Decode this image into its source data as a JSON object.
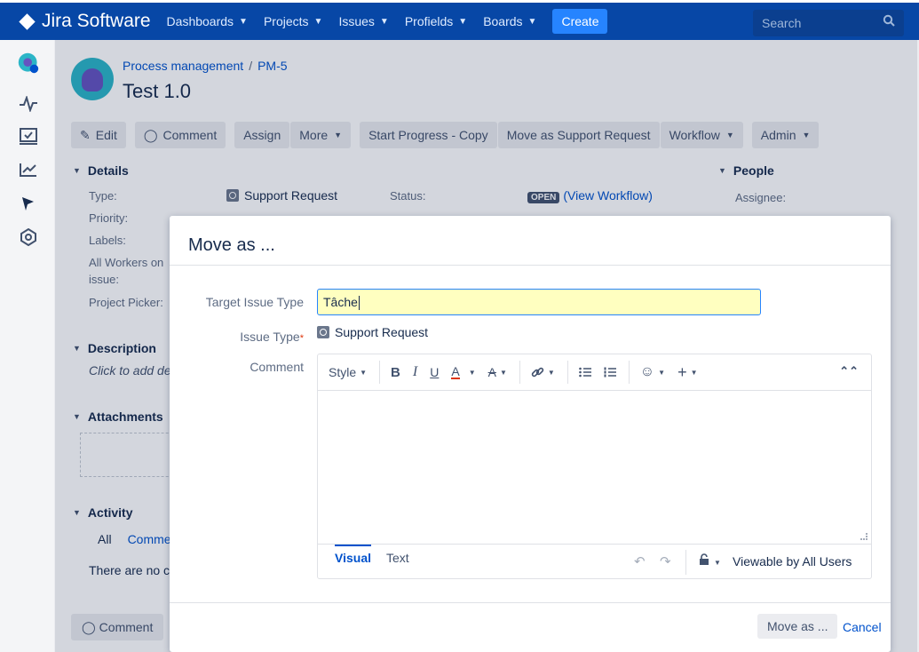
{
  "nav": {
    "brand": "Jira Software",
    "items": [
      "Dashboards",
      "Projects",
      "Issues",
      "Profields",
      "Boards"
    ],
    "create": "Create",
    "search_placeholder": "Search"
  },
  "issue": {
    "breadcrumb_project": "Process management",
    "breadcrumb_key": "PM-5",
    "title": "Test 1.0",
    "toolbar": {
      "edit": "Edit",
      "comment": "Comment",
      "assign": "Assign",
      "more": "More",
      "start_progress": "Start Progress - Copy",
      "move_support": "Move as Support Request",
      "workflow": "Workflow",
      "admin": "Admin"
    },
    "details": {
      "heading": "Details",
      "type_label": "Type:",
      "type_value": "Support Request",
      "priority_label": "Priority:",
      "labels_label": "Labels:",
      "workers_label": "All Workers on",
      "workers_label2": "issue:",
      "picker_label": "Project Picker:",
      "status_label": "Status:",
      "status_value": "OPEN",
      "view_workflow": "(View Workflow)"
    },
    "people": {
      "heading": "People",
      "assignee_label": "Assignee:"
    },
    "description": {
      "heading": "Description",
      "placeholder": "Click to add de"
    },
    "attachments": {
      "heading": "Attachments"
    },
    "activity": {
      "heading": "Activity",
      "tab_all": "All",
      "tab_comments": "Comme",
      "empty": "There are no co"
    },
    "bottom_comment": "Comment"
  },
  "dialog": {
    "title": "Move as ...",
    "target_label": "Target Issue Type",
    "target_value": "Tâche",
    "issue_type_label": "Issue Type",
    "issue_type_value": "Support Request",
    "comment_label": "Comment",
    "editor": {
      "style": "Style",
      "tab_visual": "Visual",
      "tab_text": "Text",
      "viewable": "Viewable by All Users"
    },
    "move_button": "Move as ...",
    "cancel": "Cancel"
  }
}
